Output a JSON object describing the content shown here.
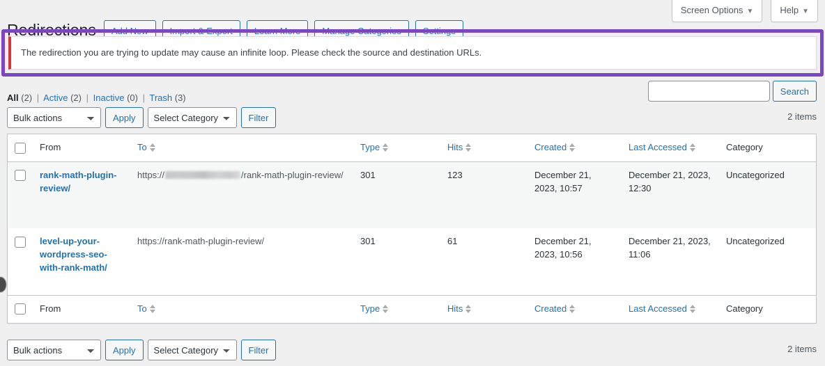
{
  "screen_meta": {
    "screen_options_label": "Screen Options",
    "help_label": "Help",
    "caret": "▼"
  },
  "header": {
    "title": "Redirections",
    "actions": [
      {
        "label": "Add New",
        "name": "add-new-button"
      },
      {
        "label": "Import & Export",
        "name": "import-export-button"
      },
      {
        "label": "Learn More",
        "name": "learn-more-button"
      },
      {
        "label": "Manage Categories",
        "name": "manage-categories-button"
      },
      {
        "label": "Settings",
        "name": "settings-button"
      }
    ]
  },
  "notice": {
    "message": "The redirection you are trying to update may cause an infinite loop. Please check the source and destination URLs.",
    "accent_color": "#d63638",
    "highlight_color": "#7b46c3"
  },
  "status_links": {
    "all": {
      "label": "All",
      "count": "(2)"
    },
    "active": {
      "label": "Active",
      "count": "(2)"
    },
    "inactive": {
      "label": "Inactive",
      "count": "(0)"
    },
    "trash": {
      "label": "Trash",
      "count": "(3)"
    },
    "separator": "|"
  },
  "search": {
    "value": "",
    "placeholder": "",
    "button_label": "Search"
  },
  "tablenav": {
    "bulk_actions_label": "Bulk actions",
    "apply_label": "Apply",
    "select_category_label": "Select Category",
    "filter_label": "Filter",
    "items_count_top": "2 items",
    "items_count_bottom": "2 items"
  },
  "table": {
    "columns": [
      {
        "key": "from",
        "label": "From",
        "sortable": false
      },
      {
        "key": "to",
        "label": "To",
        "sortable": true
      },
      {
        "key": "type",
        "label": "Type",
        "sortable": true
      },
      {
        "key": "hits",
        "label": "Hits",
        "sortable": true
      },
      {
        "key": "created",
        "label": "Created",
        "sortable": true
      },
      {
        "key": "accessed",
        "label": "Last Accessed",
        "sortable": true
      },
      {
        "key": "category",
        "label": "Category",
        "sortable": false
      }
    ],
    "rows": [
      {
        "from": "rank-math-plugin-review/",
        "to_prefix": "https://",
        "to_redacted": true,
        "to_suffix": "/rank-math-plugin-review/",
        "type": "301",
        "hits": "123",
        "created": "December 21, 2023, 10:57",
        "accessed": "December 21, 2023, 12:30",
        "category": "Uncategorized"
      },
      {
        "from": "level-up-your-wordpress-seo-with-rank-math/",
        "to_prefix": "https://rank-math-plugin-review/",
        "to_redacted": false,
        "to_suffix": "",
        "type": "301",
        "hits": "61",
        "created": "December 21, 2023, 10:56",
        "accessed": "December 21, 2023, 11:06",
        "category": "Uncategorized"
      }
    ]
  }
}
